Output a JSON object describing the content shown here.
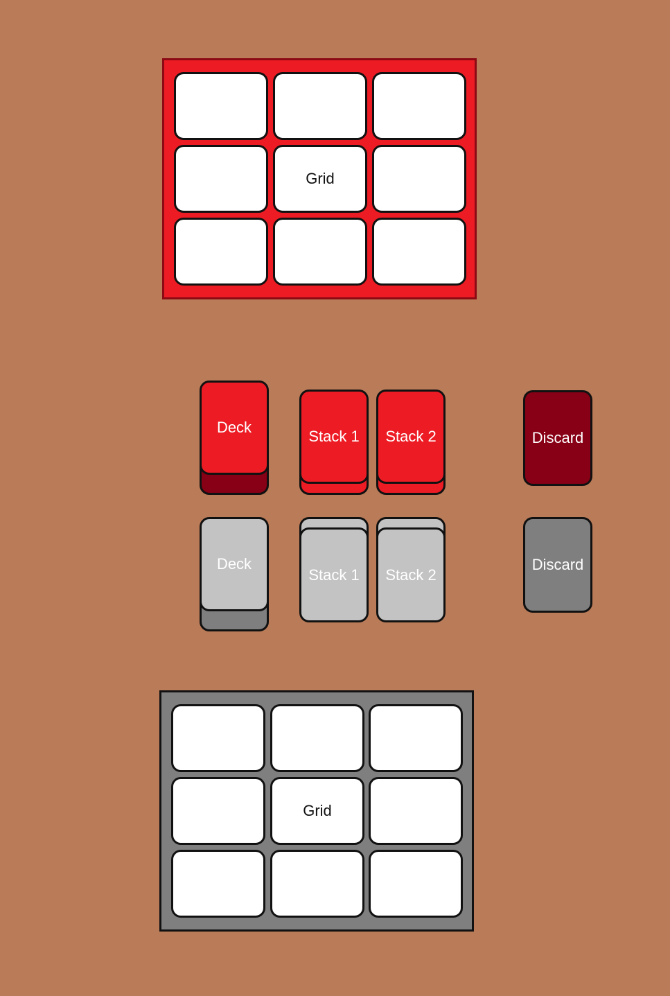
{
  "colors": {
    "table_bg": "#b97b58",
    "red_card": "#ed1c24",
    "dark_red": "#880015",
    "light_gray_card": "#c3c3c3",
    "gray_card": "#7f7f7f",
    "cell_white": "#ffffff",
    "outline": "#111111"
  },
  "top_player": {
    "grid_label": "Grid",
    "deck_label": "Deck",
    "stack1_label": "Stack 1",
    "stack2_label": "Stack 2",
    "discard_label": "Discard"
  },
  "bottom_player": {
    "grid_label": "Grid",
    "deck_label": "Deck",
    "stack1_label": "Stack 1",
    "stack2_label": "Stack 2",
    "discard_label": "Discard"
  }
}
